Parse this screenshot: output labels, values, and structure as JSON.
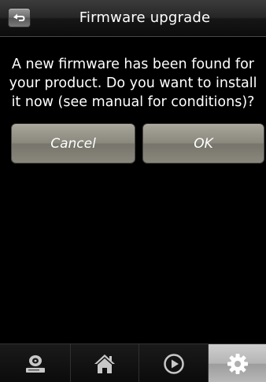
{
  "header": {
    "title": "Firmware upgrade",
    "back_icon": "back-arrow-icon"
  },
  "dialog": {
    "message": "A new firmware has been found for your product. Do you want to install it now (see manual for conditions)?",
    "cancel_label": "Cancel",
    "ok_label": "OK"
  },
  "nav": {
    "items": [
      {
        "icon": "media-device-icon",
        "selected": false
      },
      {
        "icon": "home-icon",
        "selected": false
      },
      {
        "icon": "play-icon",
        "selected": false
      },
      {
        "icon": "gear-icon",
        "selected": true
      }
    ]
  },
  "colors": {
    "background": "#000000",
    "button_fill": "#8b897e",
    "text": "#ffffff",
    "selected_tab": "#b4b4b4"
  }
}
